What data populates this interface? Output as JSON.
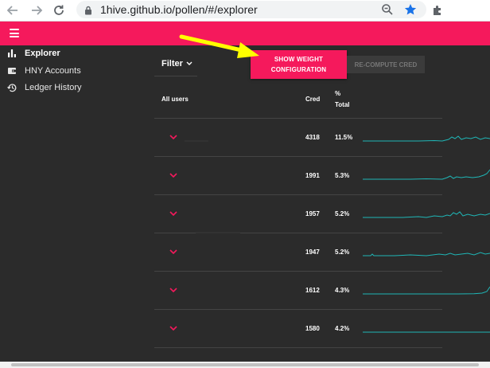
{
  "browser": {
    "url": "1hive.github.io/pollen/#/explorer",
    "icons": [
      "back-arrow-icon",
      "forward-arrow-icon",
      "reload-icon",
      "lock-icon",
      "zoom-icon",
      "star-icon",
      "extension-icon"
    ]
  },
  "colors": {
    "accent": "#f5195c",
    "background": "#2b2b2b",
    "spark": "#1fb6b6",
    "annotation": "#ffff00"
  },
  "sidebar": {
    "items": [
      {
        "label": "Explorer",
        "icon": "bar-chart-icon",
        "active": true
      },
      {
        "label": "HNY Accounts",
        "icon": "wallet-icon",
        "active": false
      },
      {
        "label": "Ledger History",
        "icon": "history-icon",
        "active": false
      }
    ]
  },
  "toolbar": {
    "filter_label": "Filter",
    "weights_label_line1": "SHOW WEIGHT",
    "weights_label_line2": "CONFIGURATION",
    "recompute_label": "RE-COMPUTE CRED"
  },
  "table": {
    "headers": {
      "users": "All users",
      "cred": "Cred",
      "pct_line1": "%",
      "pct_line2": "Total"
    },
    "rows": [
      {
        "cred": "4318",
        "pct": "11.5%"
      },
      {
        "cred": "1991",
        "pct": "5.3%"
      },
      {
        "cred": "1957",
        "pct": "5.2%"
      },
      {
        "cred": "1947",
        "pct": "5.2%"
      },
      {
        "cred": "1612",
        "pct": "4.3%"
      },
      {
        "cred": "1580",
        "pct": "4.2%"
      }
    ]
  }
}
